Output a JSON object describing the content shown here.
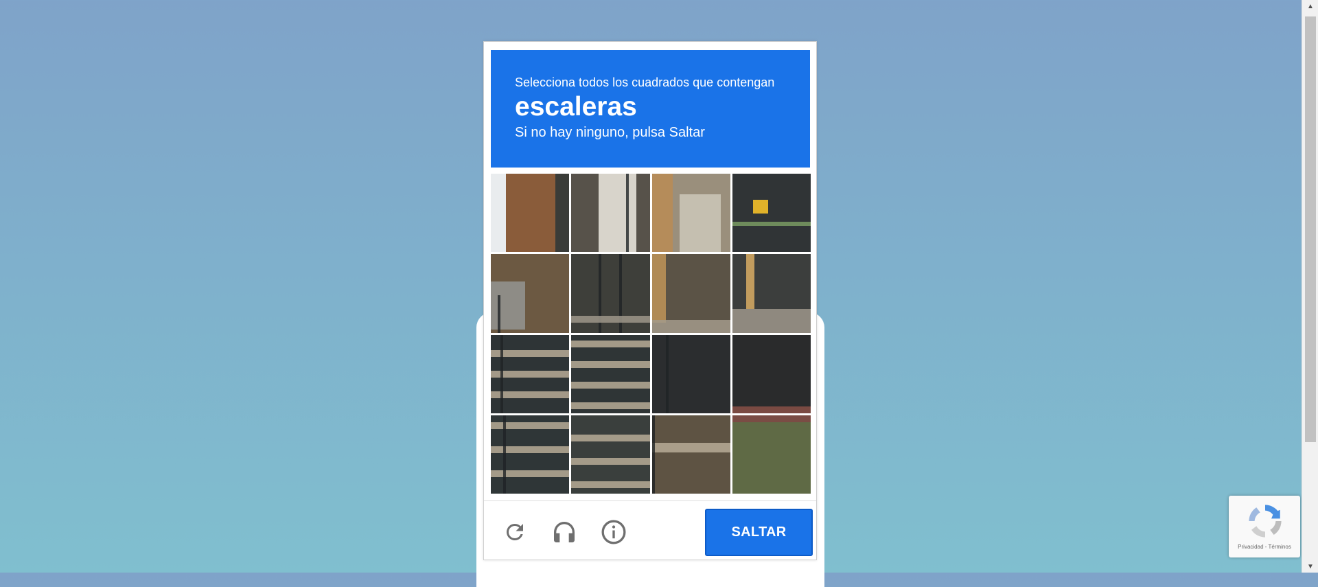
{
  "captcha": {
    "instruction": "Selecciona todos los cuadrados que contengan",
    "target": "escaleras",
    "hint": "Si no hay ninguno, pulsa Saltar",
    "skip_label": "SALTAR",
    "accent_color": "#1a73e8",
    "tile_count": 16
  },
  "badge": {
    "text": "Privacidad - Términos"
  },
  "icons": {
    "reload": "reload-icon",
    "audio": "headphones-icon",
    "info": "info-icon"
  }
}
